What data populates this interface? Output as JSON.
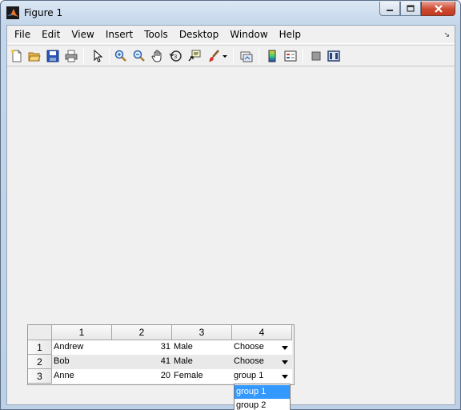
{
  "window": {
    "title": "Figure 1"
  },
  "menubar": {
    "items": [
      "File",
      "Edit",
      "View",
      "Insert",
      "Tools",
      "Desktop",
      "Window",
      "Help"
    ]
  },
  "toolbar": {
    "buttons": [
      "new-figure-icon",
      "open-file-icon",
      "save-icon",
      "print-icon",
      "pointer-icon",
      "zoom-in-icon",
      "zoom-out-icon",
      "pan-icon",
      "rotate-3d-icon",
      "data-cursor-icon",
      "brush-icon",
      "brush-dropdown-icon",
      "link-plot-icon",
      "colorbar-icon",
      "legend-icon",
      "hide-plot-tools-icon",
      "show-plot-tools-icon"
    ]
  },
  "table": {
    "column_headers": [
      "1",
      "2",
      "3",
      "4"
    ],
    "row_headers": [
      "1",
      "2",
      "3"
    ],
    "rows": [
      {
        "name": "Andrew",
        "age": "31",
        "gender": "Male",
        "group": "Choose"
      },
      {
        "name": "Bob",
        "age": "41",
        "gender": "Male",
        "group": "Choose"
      },
      {
        "name": "Anne",
        "age": "20",
        "gender": "Female",
        "group": "group 1"
      }
    ]
  },
  "dropdown": {
    "options": [
      "group 1",
      "group 2"
    ],
    "highlighted": "group 1"
  },
  "colors": {
    "selection": "#3399ff",
    "close_button": "#c53a22",
    "client_background": "#f0f0f0"
  }
}
